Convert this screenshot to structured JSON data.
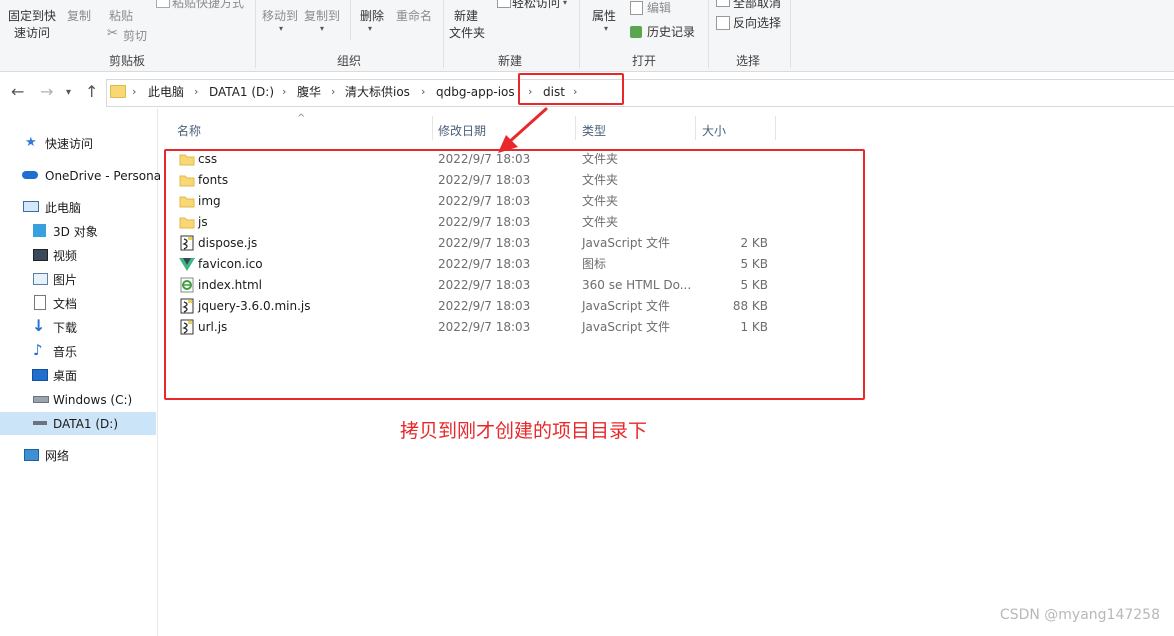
{
  "ribbon": {
    "pin_quick_access": [
      "固定到快",
      "速访问"
    ],
    "copy": "复制",
    "paste": "粘贴",
    "paste_shortcut": "粘贴快捷方式",
    "cut": "剪切",
    "clipboard_group": "剪贴板",
    "move_to": "移动到",
    "copy_to": "复制到",
    "delete": "删除",
    "rename": "重命名",
    "organize_group": "组织",
    "new_folder": [
      "新建",
      "文件夹"
    ],
    "easy_access": "轻松访问",
    "new_group": "新建",
    "properties": "属性",
    "edit": "编辑",
    "history": "历史记录",
    "open_group": "打开",
    "select_none": "全部取消",
    "invert_selection": "反向选择",
    "select_group": "选择"
  },
  "address": {
    "crumbs": [
      "此电脑",
      "DATA1 (D:)",
      "腹华",
      "清大标供ios",
      "qdbg-app-ios",
      "dist"
    ]
  },
  "nav": {
    "quick_access": "快速访问",
    "onedrive": "OneDrive - Persona",
    "this_pc": "此电脑",
    "objects_3d": "3D 对象",
    "videos": "视频",
    "pictures": "图片",
    "documents": "文档",
    "downloads": "下载",
    "music": "音乐",
    "desktop": "桌面",
    "windows_c": "Windows (C:)",
    "data1_d": "DATA1 (D:)",
    "network": "网络"
  },
  "columns": {
    "name": "名称",
    "modified": "修改日期",
    "type": "类型",
    "size": "大小"
  },
  "files": [
    {
      "name": "css",
      "modified": "2022/9/7 18:03",
      "type": "文件夹",
      "size": "",
      "icon": "folder"
    },
    {
      "name": "fonts",
      "modified": "2022/9/7 18:03",
      "type": "文件夹",
      "size": "",
      "icon": "folder"
    },
    {
      "name": "img",
      "modified": "2022/9/7 18:03",
      "type": "文件夹",
      "size": "",
      "icon": "folder"
    },
    {
      "name": "js",
      "modified": "2022/9/7 18:03",
      "type": "文件夹",
      "size": "",
      "icon": "folder"
    },
    {
      "name": "dispose.js",
      "modified": "2022/9/7 18:03",
      "type": "JavaScript 文件",
      "size": "2 KB",
      "icon": "js"
    },
    {
      "name": "favicon.ico",
      "modified": "2022/9/7 18:03",
      "type": "图标",
      "size": "5 KB",
      "icon": "vue"
    },
    {
      "name": "index.html",
      "modified": "2022/9/7 18:03",
      "type": "360 se HTML Do...",
      "size": "5 KB",
      "icon": "html"
    },
    {
      "name": "jquery-3.6.0.min.js",
      "modified": "2022/9/7 18:03",
      "type": "JavaScript 文件",
      "size": "88 KB",
      "icon": "js"
    },
    {
      "name": "url.js",
      "modified": "2022/9/7 18:03",
      "type": "JavaScript 文件",
      "size": "1 KB",
      "icon": "js"
    }
  ],
  "annotation": "拷贝到刚才创建的项目目录下",
  "watermark": "CSDN @myang147258",
  "colors": {
    "highlight": "#e8282b",
    "selection": "#cce4f7",
    "folder": "#f8d775"
  }
}
